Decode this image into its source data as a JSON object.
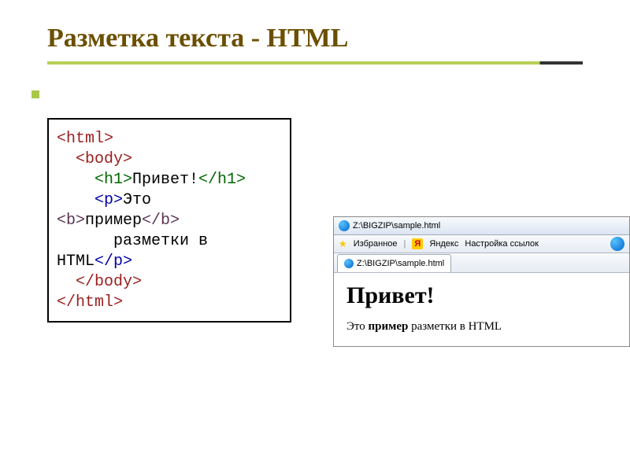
{
  "slide": {
    "title": "Разметка текста - HTML"
  },
  "code": {
    "open_html": "<html>",
    "open_body": "<body>",
    "open_h1": "<h1>",
    "text_h1": "Привет!",
    "close_h1": "</h1>",
    "open_p": "<p>",
    "text_p1": "Это",
    "open_b": "<b>",
    "text_b": "пример",
    "close_b": "</b>",
    "text_p2": "разметки в",
    "text_p3": "HTML",
    "close_p": "</p>",
    "close_body": "</body>",
    "close_html": "</html>"
  },
  "browser": {
    "titlebar": "Z:\\BIGZIP\\sample.html",
    "fav_label": "Избранное",
    "ya_label": "Яндекс",
    "links_label": "Настройка ссылок",
    "tab": "Z:\\BIGZIP\\sample.html",
    "h1": "Привет!",
    "p_prefix": "Это ",
    "p_bold": "пример",
    "p_suffix": " разметки в HTML"
  }
}
